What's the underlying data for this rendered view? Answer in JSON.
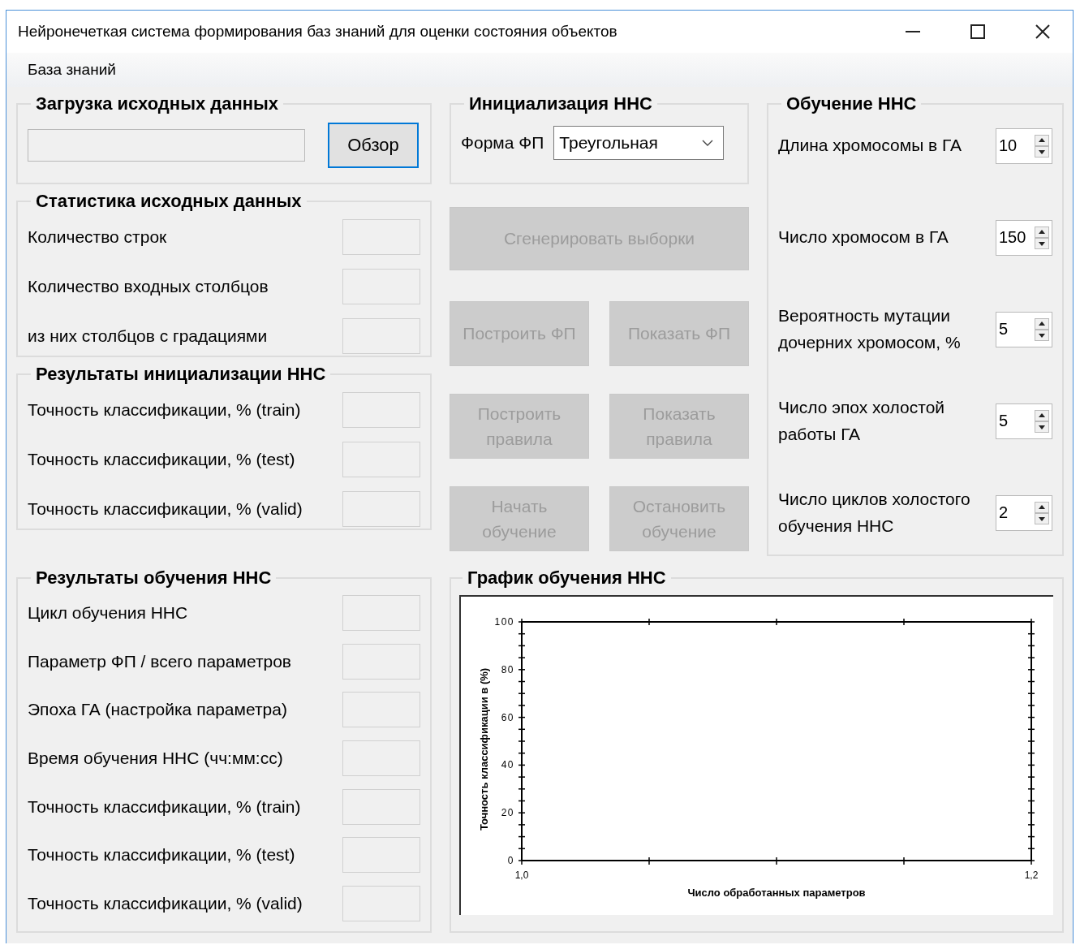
{
  "window": {
    "title": "Нейронечеткая система формирования баз знаний для оценки состояния объектов"
  },
  "menu": [
    "База знаний"
  ],
  "load_group": {
    "title": "Загрузка исходных данных",
    "browse_button": {
      "label": "Обзор",
      "disabled": false
    }
  },
  "stats_group": {
    "title": "Статистика исходных данных",
    "rows": [
      {
        "label": "Количество строк"
      },
      {
        "label": "Количество входных столбцов"
      },
      {
        "label": "из них столбцов с градациями"
      }
    ]
  },
  "init_results_group": {
    "title": "Результаты инициализации ННС",
    "rows": [
      {
        "label": "Точность классификации, % (train)"
      },
      {
        "label": "Точность классификации, % (test)"
      },
      {
        "label": "Точность классификации, % (valid)"
      }
    ]
  },
  "train_results_group": {
    "title": "Результаты обучения ННС",
    "rows": [
      {
        "label": "Цикл обучения ННС"
      },
      {
        "label": "Параметр ФП / всего параметров"
      },
      {
        "label": "Эпоха ГА (настройка параметра)"
      },
      {
        "label": "Время обучения ННС (чч:мм:сс)"
      },
      {
        "label": "Точность классификации, % (train)"
      },
      {
        "label": "Точность классификации, % (test)"
      },
      {
        "label": "Точность классификации, % (valid)"
      }
    ]
  },
  "init_group": {
    "title": "Инициализация ННС",
    "mf_label": "Форма ФП",
    "mf_value": "Треугольная"
  },
  "actions": [
    {
      "label": "Сгенерировать выборки",
      "disabled": true
    },
    {
      "label": "Построить ФП",
      "disabled": true
    },
    {
      "label": "Показать ФП",
      "disabled": true
    },
    {
      "label": "Построить правила",
      "disabled": true
    },
    {
      "label": "Показать правила",
      "disabled": true
    },
    {
      "label": "Начать обучение",
      "disabled": true
    },
    {
      "label": "Остановить обучение",
      "disabled": true
    }
  ],
  "training_group": {
    "title": "Обучение ННС",
    "settings": [
      {
        "label": "Длина хромосомы в ГА",
        "value": "10"
      },
      {
        "label": "Число хромосом в ГА",
        "value": "150"
      },
      {
        "label": "Вероятность мутации дочерних хромосом, %",
        "value": "5"
      },
      {
        "label": "Число эпох холостой работы ГА",
        "value": "5"
      },
      {
        "label": "Число циклов холостого обучения ННС",
        "value": "2"
      }
    ]
  },
  "chart_group": {
    "title": "График обучения ННС",
    "chart_data": {
      "type": "line",
      "xlabel": "Число обработанных параметров",
      "ylabel": "Точность классификации в (%)",
      "xlim": [
        1.0,
        1.2
      ],
      "ylim": [
        0,
        100
      ],
      "xticks": [
        {
          "value": 1.0,
          "label": "1,0"
        },
        {
          "value": 1.2,
          "label": "1,2"
        }
      ],
      "yticks": [
        0,
        20,
        40,
        60,
        80,
        100
      ]
    }
  }
}
